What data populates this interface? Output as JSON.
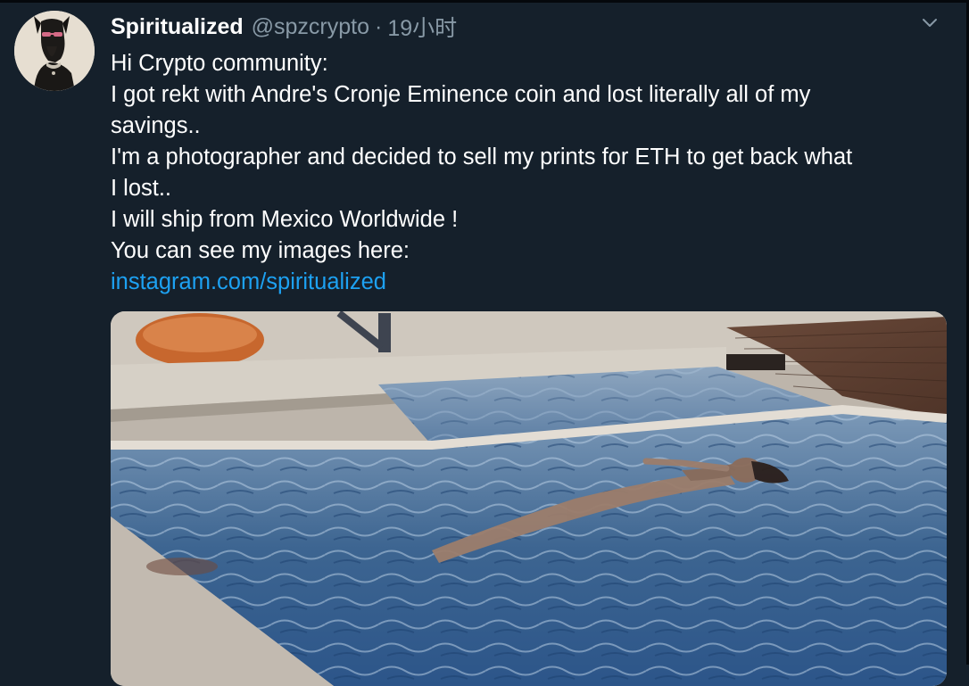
{
  "tweet": {
    "author": {
      "display_name": "Spiritualized",
      "handle": "@spzcrypto",
      "avatar_icon": "dog-with-sunglasses-avatar"
    },
    "separator": "·",
    "time": "19小时",
    "menu_icon": "chevron-down-icon",
    "text_lines": [
      "Hi Crypto community:",
      "I got rekt with Andre's Cronje Eminence coin and lost literally all of my",
      "savings..",
      "I'm a photographer and decided to sell my prints for ETH to get back what",
      "I lost..",
      "I will ship from Mexico Worldwide !",
      "You can see my images here:"
    ],
    "link": "instagram.com/spiritualized",
    "media": {
      "description_icon": "pool-photo"
    }
  },
  "colors": {
    "background": "#15202b",
    "text": "#ffffff",
    "secondary": "#8899a6",
    "link": "#1da1f2"
  }
}
